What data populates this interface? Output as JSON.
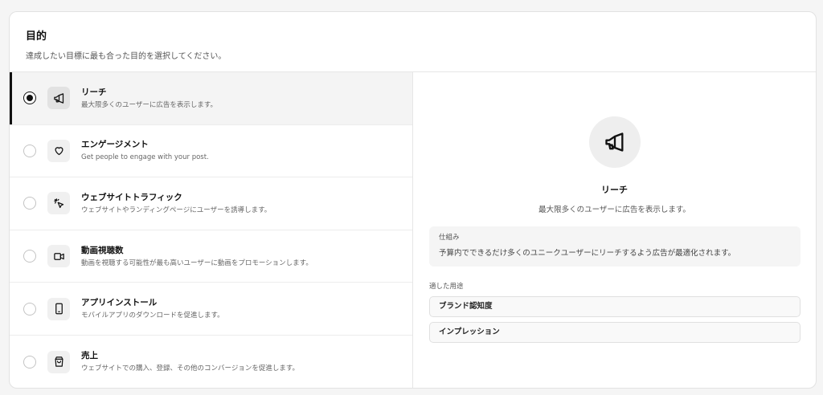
{
  "header": {
    "title": "目的",
    "subtitle": "達成したい目標に最も合った目的を選択してください。"
  },
  "objectives": [
    {
      "title": "リーチ",
      "description": "最大限多くのユーザーに広告を表示します。",
      "icon": "megaphone-icon",
      "selected": true
    },
    {
      "title": "エンゲージメント",
      "description": "Get people to engage with your post.",
      "icon": "heart-icon",
      "selected": false
    },
    {
      "title": "ウェブサイトトラフィック",
      "description": "ウェブサイトやランディングページにユーザーを誘導します。",
      "icon": "cursor-click-icon",
      "selected": false
    },
    {
      "title": "動画視聴数",
      "description": "動画を視聴する可能性が最も高いユーザーに動画をプロモーションします。",
      "icon": "video-icon",
      "selected": false
    },
    {
      "title": "アプリインストール",
      "description": "モバイルアプリのダウンロードを促進します。",
      "icon": "smartphone-icon",
      "selected": false
    },
    {
      "title": "売上",
      "description": "ウェブサイトでの購入、登録、その他のコンバージョンを促進します。",
      "icon": "shopping-bag-icon",
      "selected": false
    }
  ],
  "detail": {
    "icon": "megaphone-icon",
    "title": "リーチ",
    "description": "最大限多くのユーザーに広告を表示します。",
    "mechanism_label": "仕組み",
    "mechanism_text": "予算内でできるだけ多くのユニークユーザーにリーチするよう広告が最適化されます。",
    "uses_label": "適した用途",
    "uses": [
      "ブランド認知度",
      "インプレッション"
    ]
  },
  "colors": {
    "accent": "#111111",
    "selected_bg": "#f4f4f4",
    "border": "#e6e6e6"
  }
}
